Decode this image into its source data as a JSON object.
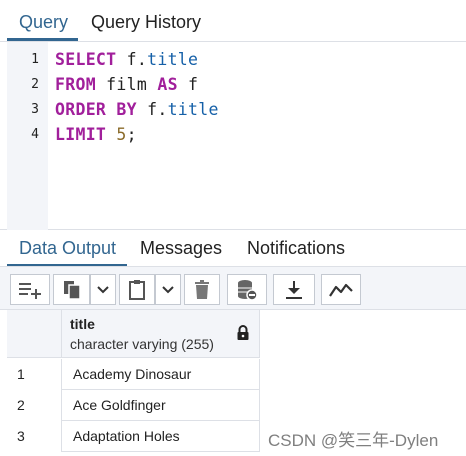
{
  "query_tabs": [
    {
      "label": "Query",
      "active": true
    },
    {
      "label": "Query History",
      "active": false
    }
  ],
  "editor": {
    "line_numbers": [
      "1",
      "2",
      "3",
      "4"
    ],
    "lines": [
      [
        {
          "t": "SELECT",
          "k": "kw"
        },
        {
          "t": " ",
          "k": "id"
        },
        {
          "t": "f",
          "k": "id"
        },
        {
          "t": ".",
          "k": "punct"
        },
        {
          "t": "title",
          "k": "prop"
        }
      ],
      [
        {
          "t": "FROM",
          "k": "kw"
        },
        {
          "t": " film ",
          "k": "id"
        },
        {
          "t": "AS",
          "k": "kw"
        },
        {
          "t": " f",
          "k": "id"
        }
      ],
      [
        {
          "t": "ORDER BY",
          "k": "kw"
        },
        {
          "t": " f",
          "k": "id"
        },
        {
          "t": ".",
          "k": "punct"
        },
        {
          "t": "title",
          "k": "prop"
        }
      ],
      [
        {
          "t": "LIMIT",
          "k": "kw"
        },
        {
          "t": " ",
          "k": "id"
        },
        {
          "t": "5",
          "k": "num"
        },
        {
          "t": ";",
          "k": "punct"
        }
      ]
    ]
  },
  "output_tabs": [
    {
      "label": "Data Output",
      "active": true
    },
    {
      "label": "Messages",
      "active": false
    },
    {
      "label": "Notifications",
      "active": false
    }
  ],
  "toolbar": {
    "icons": [
      "add-row-icon",
      "copy-icon",
      "copy-dropdown-icon",
      "paste-icon",
      "paste-dropdown-icon",
      "delete-icon",
      "save-data-icon",
      "download-icon",
      "graph-visualiser-icon"
    ]
  },
  "grid": {
    "column": {
      "name": "title",
      "type": "character varying (255)",
      "icon": "lock-icon"
    },
    "rows": [
      {
        "num": "1",
        "title": "Academy Dinosaur"
      },
      {
        "num": "2",
        "title": "Ace Goldfinger"
      },
      {
        "num": "3",
        "title": "Adaptation Holes"
      }
    ]
  },
  "watermark": "CSDN @笑三年-Dylen",
  "colors": {
    "accent": "#326690",
    "keyword": "#a11f9b",
    "property": "#1560a8",
    "number": "#8b6b2a",
    "panel_bg": "#f3f5f9",
    "border": "#dde0e6"
  }
}
